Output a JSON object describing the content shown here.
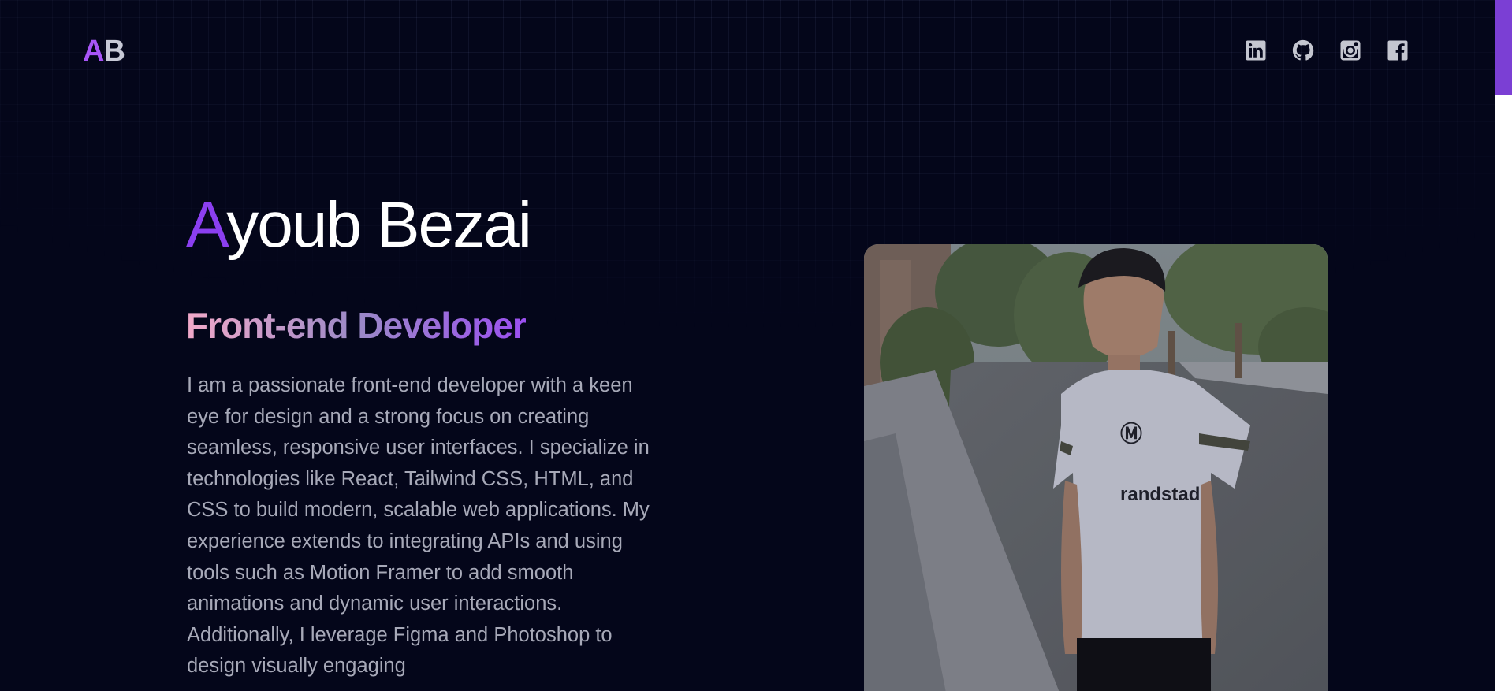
{
  "header": {
    "logo_initial_1": "A",
    "logo_initial_2": "B",
    "socials": [
      {
        "name": "linkedin",
        "icon": "linkedin-icon"
      },
      {
        "name": "github",
        "icon": "github-icon"
      },
      {
        "name": "instagram",
        "icon": "instagram-icon"
      },
      {
        "name": "facebook",
        "icon": "facebook-icon"
      }
    ]
  },
  "hero": {
    "name_first_letter": "A",
    "name_rest": "youb Bezai",
    "role": "Front-end Developer",
    "bio": "I am a passionate front-end developer with a keen eye for design and a strong focus on creating seamless, responsive user interfaces. I specialize in technologies like React, Tailwind CSS, HTML, and CSS to build modern, scalable web applications. My experience extends to integrating APIs and using tools such as Motion Framer to add smooth animations and dynamic user interactions. Additionally, I leverage Figma and Photoshop to design visually engaging",
    "photo_print": "randstad"
  },
  "colors": {
    "accent": "#a855f7",
    "background": "#04061a",
    "scrollbar_thumb": "#7b3fd4"
  }
}
